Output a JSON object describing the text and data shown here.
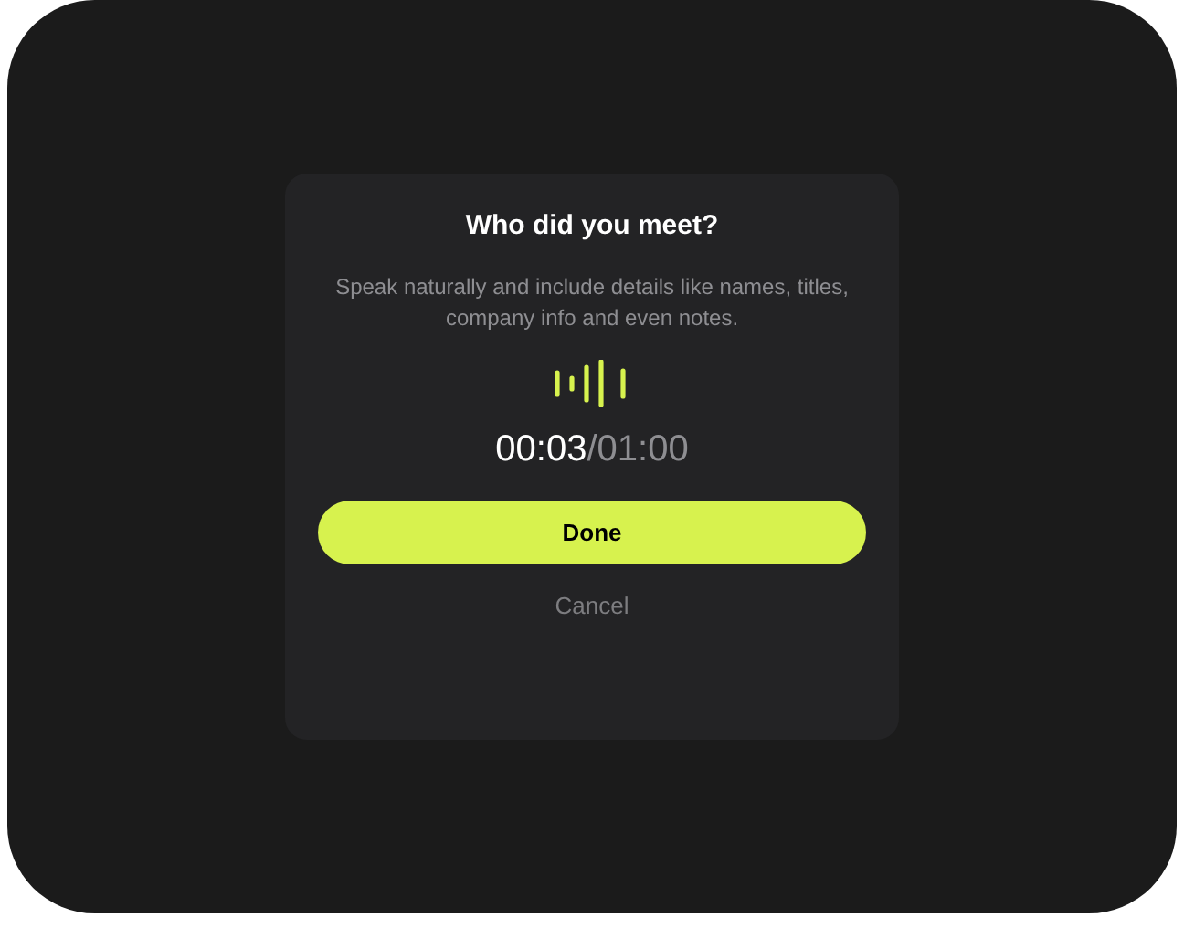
{
  "dialog": {
    "title": "Who did you meet?",
    "description": "Speak naturally and include details like names, titles, company info and even notes.",
    "timer": {
      "elapsed": "00:03",
      "total": "/01:00"
    },
    "buttons": [
      {
        "kind": "primary",
        "label": "Done"
      },
      {
        "kind": "text",
        "label": "Cancel"
      }
    ]
  }
}
